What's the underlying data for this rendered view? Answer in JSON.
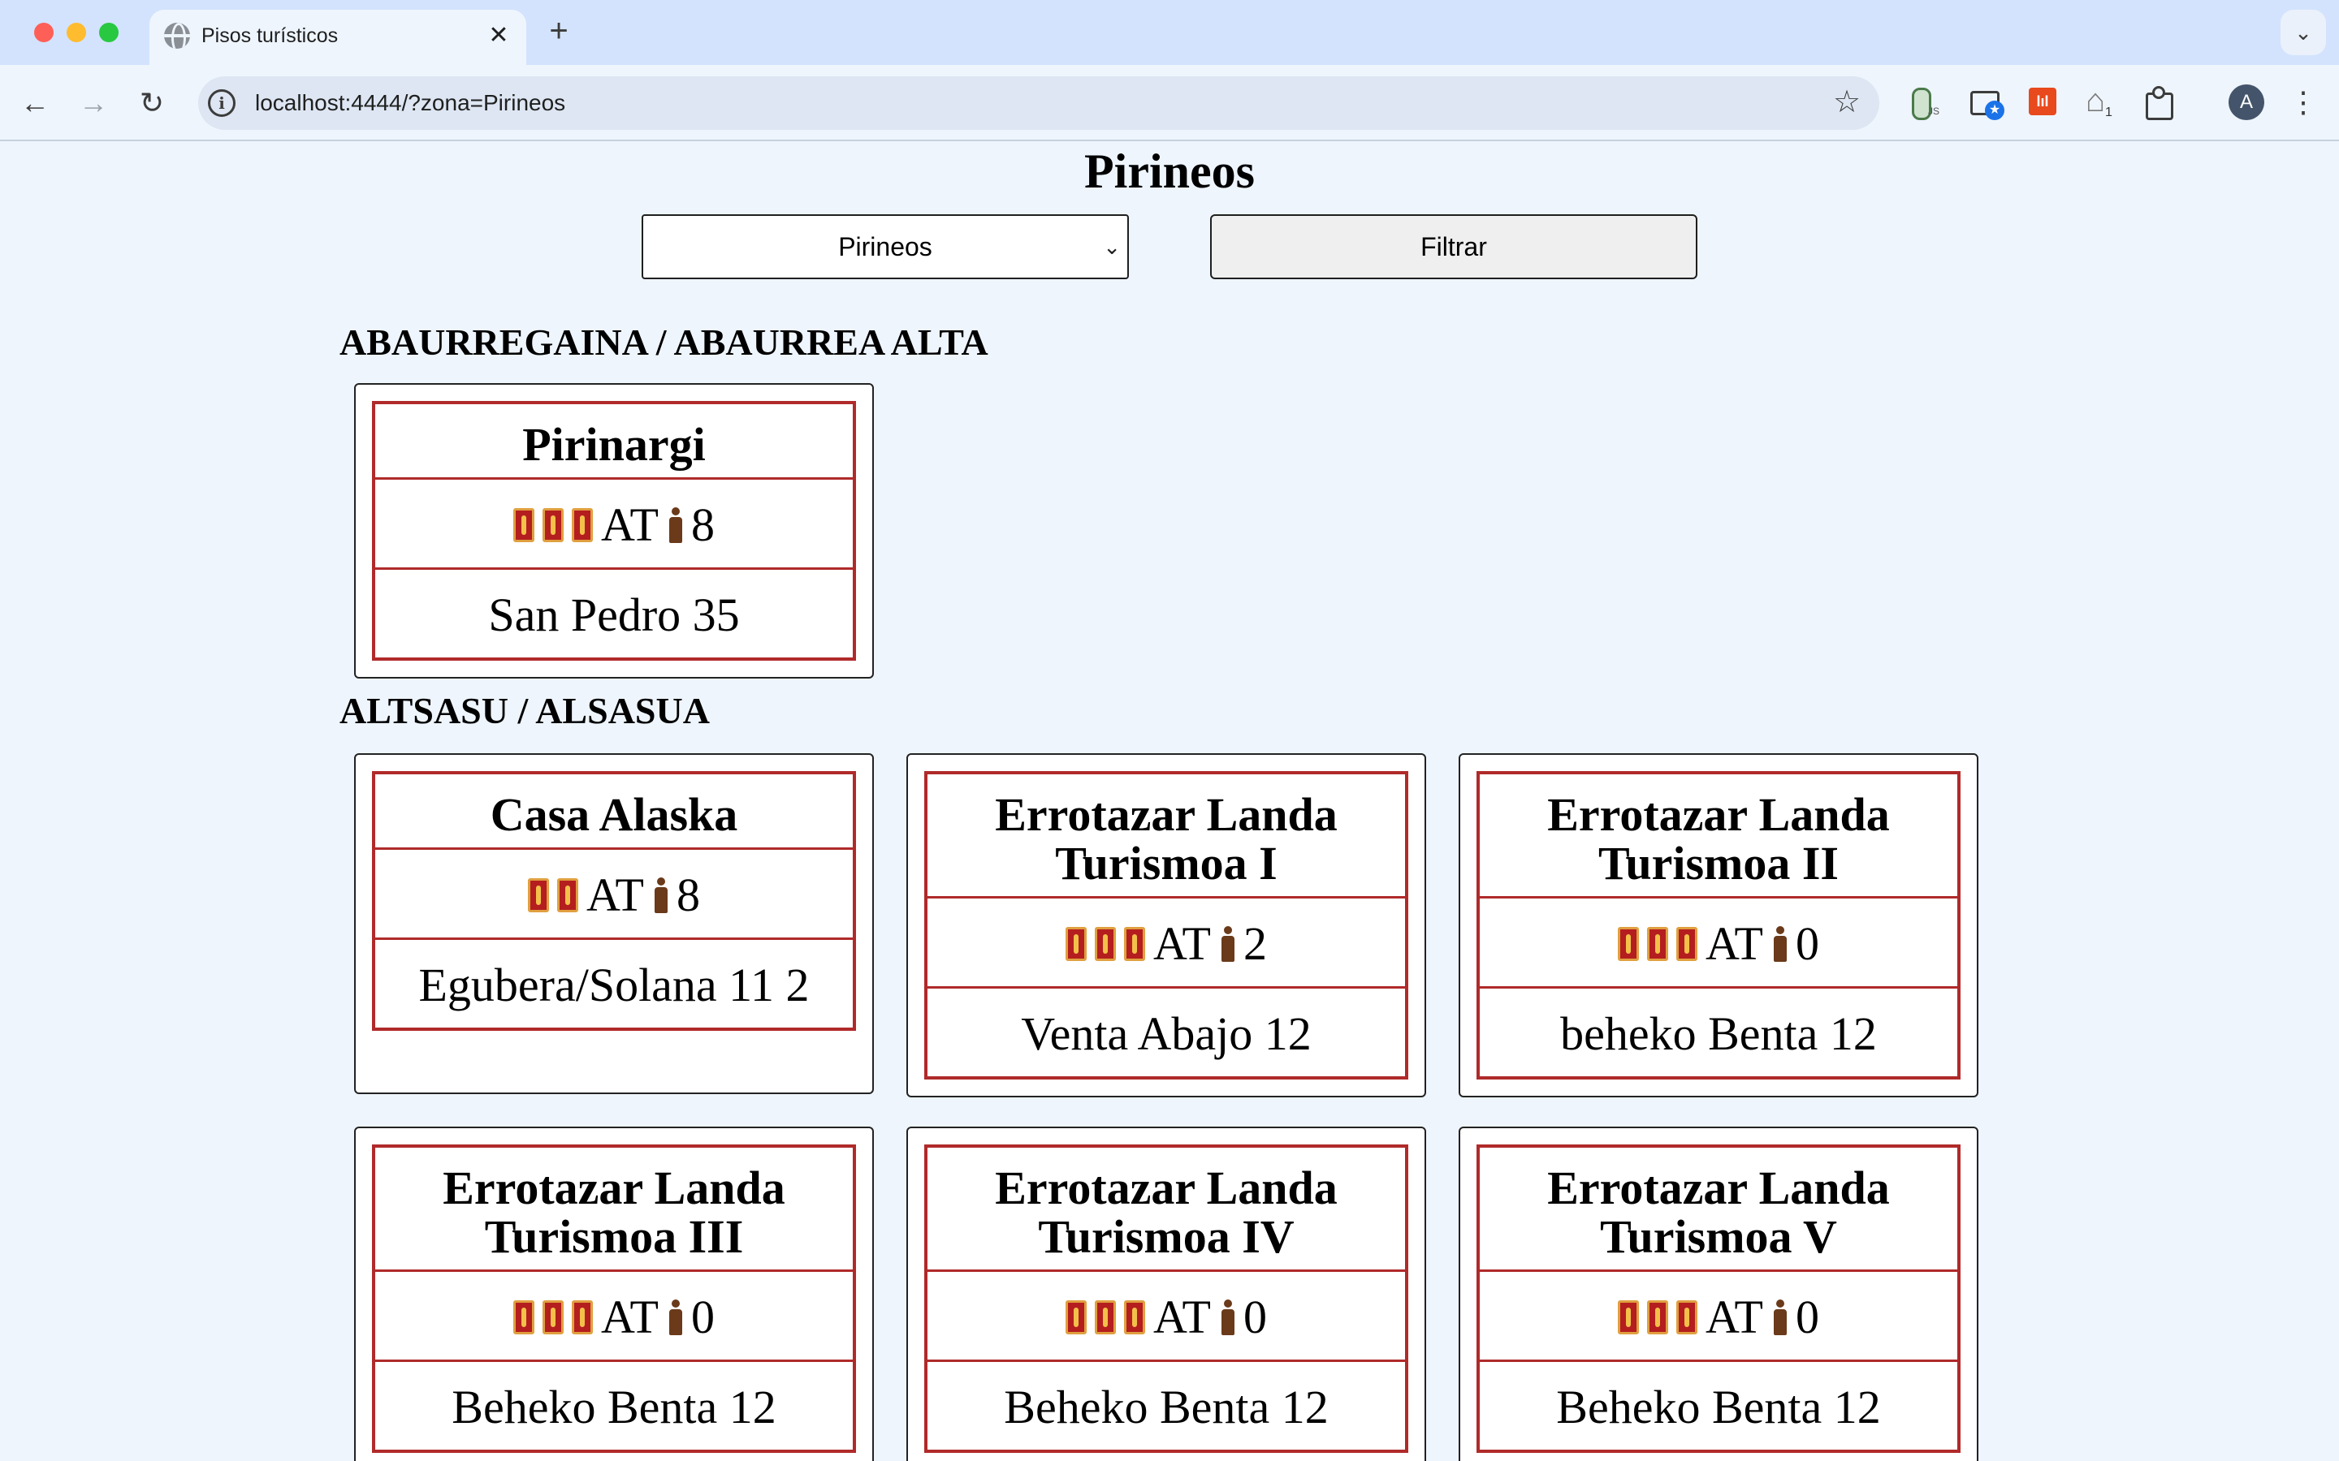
{
  "browser": {
    "tab_title": "Pisos turísticos",
    "url": "localhost:4444/?zona=Pirineos",
    "avatar_letter": "A"
  },
  "page": {
    "title": "Pirineos",
    "zone_select_value": "Pirineos",
    "filter_label": "Filtrar"
  },
  "icons": {
    "key": "key-icon",
    "guests": "person-icon",
    "key_color": "#b41e1e"
  },
  "groups": [
    {
      "town": "ABAURREGAINA / ABAURREA ALTA",
      "listings": [
        {
          "name": "Pirinargi",
          "keys": 3,
          "code": "AT",
          "guests": "8",
          "address": "San Pedro 35"
        }
      ]
    },
    {
      "town": "ALTSASU / ALSASUA",
      "listings": [
        {
          "name": "Casa Alaska",
          "keys": 2,
          "code": "AT",
          "guests": "8",
          "address": "Egubera/Solana 11 2"
        },
        {
          "name": "Errotazar Landa Turismoa I",
          "keys": 3,
          "code": "AT",
          "guests": "2",
          "address": "Venta Abajo 12"
        },
        {
          "name": "Errotazar Landa Turismoa II",
          "keys": 3,
          "code": "AT",
          "guests": "0",
          "address": "beheko Benta 12"
        },
        {
          "name": "Errotazar Landa Turismoa III",
          "keys": 3,
          "code": "AT",
          "guests": "0",
          "address": "Beheko Benta 12"
        },
        {
          "name": "Errotazar Landa Turismoa IV",
          "keys": 3,
          "code": "AT",
          "guests": "0",
          "address": "Beheko Benta 12"
        },
        {
          "name": "Errotazar Landa Turismoa V",
          "keys": 3,
          "code": "AT",
          "guests": "0",
          "address": "Beheko Benta 12"
        }
      ]
    }
  ]
}
